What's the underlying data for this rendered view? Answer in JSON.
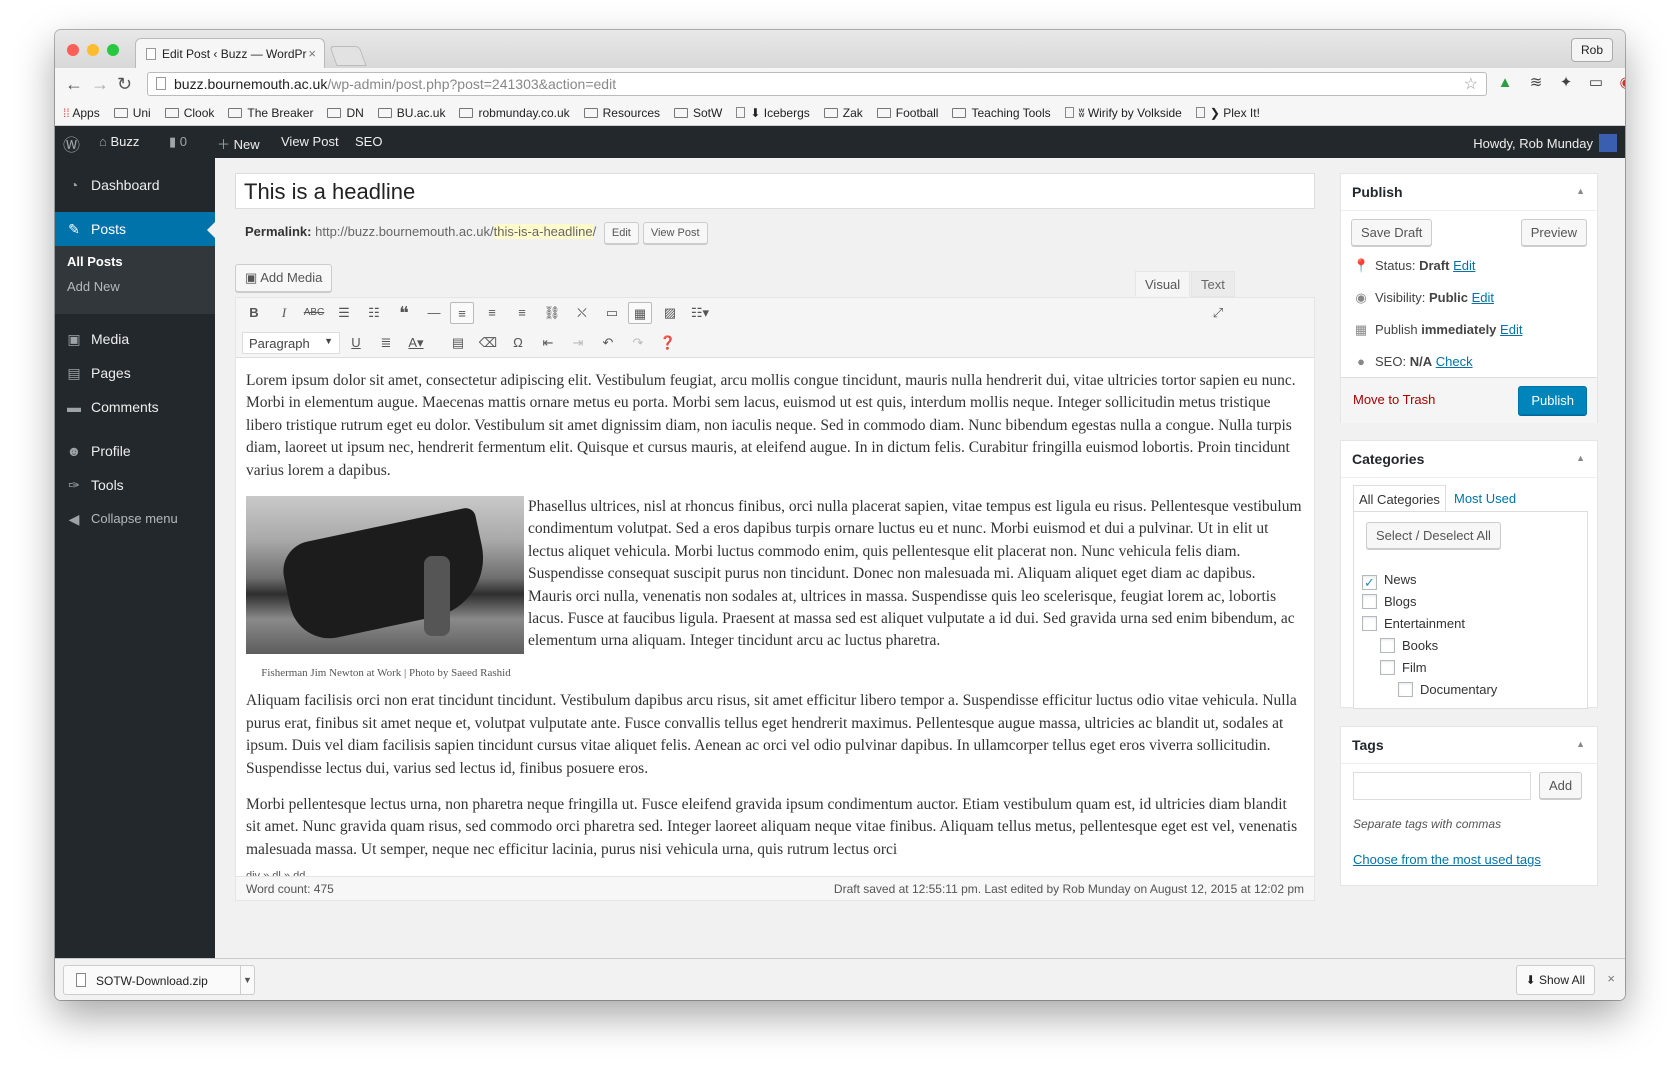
{
  "browser": {
    "tab_title": "Edit Post ‹ Buzz — WordPr",
    "user": "Rob",
    "url_host": "buzz.bournemouth.ac.uk",
    "url_path": "/wp-admin/post.php?post=241303&action=edit",
    "bookmarks": [
      "Apps",
      "Uni",
      "Clook",
      "The Breaker",
      "DN",
      "BU.ac.uk",
      "robmunday.co.uk",
      "Resources",
      "SotW",
      "⬇ Icebergs",
      "Zak",
      "Football",
      "Teaching Tools",
      "ʬ Wirify by Volkside",
      "❯ Plex It!"
    ]
  },
  "adminbar": {
    "site": "Buzz",
    "comments": "0",
    "new": "New",
    "view_post": "View Post",
    "seo": "SEO",
    "howdy": "Howdy, Rob Munday"
  },
  "sidebar": {
    "dashboard": "Dashboard",
    "posts": "Posts",
    "all_posts": "All Posts",
    "add_new": "Add New",
    "media": "Media",
    "pages": "Pages",
    "comments": "Comments",
    "profile": "Profile",
    "tools": "Tools",
    "collapse": "Collapse menu"
  },
  "post": {
    "title": "This is a headline",
    "permalink_label": "Permalink:",
    "permalink_base": "http://buzz.bournemouth.ac.uk/",
    "permalink_slug": "this-is-a-headline",
    "permalink_end": "/",
    "edit_btn": "Edit",
    "view_btn": "View Post",
    "add_media": "Add Media",
    "tab_visual": "Visual",
    "tab_text": "Text",
    "format": "Paragraph",
    "p1": "Lorem ipsum dolor sit amet, consectetur adipiscing elit. Vestibulum feugiat, arcu mollis congue tincidunt, mauris nulla hendrerit dui, vitae ultricies tortor sapien eu nunc. Morbi in elementum augue. Maecenas mattis ornare metus eu porta. Morbi sem lacus, euismod ut est quis, interdum mollis neque. Integer sollicitudin metus tristique libero tristique rutrum eget eu dolor. Vestibulum sit amet dignissim diam, non iaculis neque. Sed in commodo diam. Nunc bibendum egestas nulla a congue. Nulla turpis diam, laoreet ut ipsum nec, hendrerit fermentum elit. Quisque et cursus mauris, at eleifend augue. In in dictum felis. Curabitur fringilla euismod lobortis. Proin tincidunt varius lorem a dapibus.",
    "caption": "Fisherman Jim Newton at Work | Photo by Saeed Rashid",
    "p2": "Phasellus ultrices, nisl at rhoncus finibus, orci nulla placerat sapien, vitae tempus est ligula eu risus. Pellentesque vestibulum condimentum volutpat. Sed a eros dapibus turpis ornare luctus eu et nunc. Morbi euismod et dui a pulvinar. Ut in elit ut lectus aliquet vehicula. Morbi luctus commodo enim, quis pellentesque elit placerat non. Nunc vehicula felis diam. Suspendisse consequat suscipit purus non tincidunt. Donec non malesuada mi. Aliquam aliquet eget diam ac dapibus. Mauris orci nulla, venenatis non sodales at, ultrices in massa. Suspendisse quis leo scelerisque, feugiat lorem ac, lobortis lacus. Fusce at faucibus ligula. Praesent at massa sed est aliquet vulputate a id dui. Sed gravida urna sed enim bibendum, ac elementum urna aliquam. Integer tincidunt arcu ac luctus pharetra.",
    "p3": "Aliquam facilisis orci non erat tincidunt tincidunt. Vestibulum dapibus arcu risus, sit amet efficitur libero tempor a. Suspendisse efficitur luctus odio vitae vehicula. Nulla purus erat, finibus sit amet neque et, volutpat vulputate ante. Fusce convallis tellus eget hendrerit maximus. Pellentesque augue massa, ultricies ac blandit ut, sodales at ipsum. Duis vel diam facilisis sapien tincidunt cursus vitae aliquet felis. Aenean ac orci vel odio pulvinar dapibus. In ullamcorper tellus eget eros viverra sollicitudin. Suspendisse lectus dui, varius sed lectus id, finibus posuere eros.",
    "p4": "Morbi pellentesque lectus urna, non pharetra neque fringilla ut. Fusce eleifend gravida ipsum condimentum auctor. Etiam vestibulum quam est, id ultricies diam blandit sit amet. Nunc gravida quam risus, sed commodo orci pharetra sed. Integer laoreet aliquam neque vitae finibus. Aliquam tellus metus, pellentesque eget est vel, venenatis malesuada massa. Ut semper, neque nec efficitur lacinia, purus nisi vehicula urna, quis rutrum lectus orci",
    "path": "div » dl » dd",
    "word_count": "Word count: 475",
    "draft_status": "Draft saved at 12:55:11 pm. Last edited by Rob Munday on August 12, 2015 at 12:02 pm"
  },
  "publish": {
    "title": "Publish",
    "save_draft": "Save Draft",
    "preview": "Preview",
    "status_label": "Status:",
    "status_value": "Draft",
    "visibility_label": "Visibility:",
    "visibility_value": "Public",
    "publish_label": "Publish",
    "publish_value": "immediately",
    "seo_label": "SEO:",
    "seo_value": "N/A",
    "edit": "Edit",
    "check": "Check",
    "trash": "Move to Trash",
    "publish_btn": "Publish"
  },
  "categories": {
    "title": "Categories",
    "tab_all": "All Categories",
    "tab_used": "Most Used",
    "select_all": "Select / Deselect All",
    "items": [
      {
        "label": "News",
        "checked": true
      },
      {
        "label": "Blogs",
        "checked": false
      },
      {
        "label": "Entertainment",
        "checked": false
      },
      {
        "label": "Books",
        "checked": false
      },
      {
        "label": "Film",
        "checked": false
      },
      {
        "label": "Documentary",
        "checked": false
      }
    ]
  },
  "tags": {
    "title": "Tags",
    "add": "Add",
    "hint": "Separate tags with commas",
    "choose": "Choose from the most used tags"
  },
  "downloads": {
    "file": "SOTW-Download.zip",
    "show_all": "Show All"
  },
  "colors": {
    "admin_dark": "#23282d",
    "accent": "#0073aa",
    "publish_btn": "#0085ba",
    "trash": "#a00"
  }
}
